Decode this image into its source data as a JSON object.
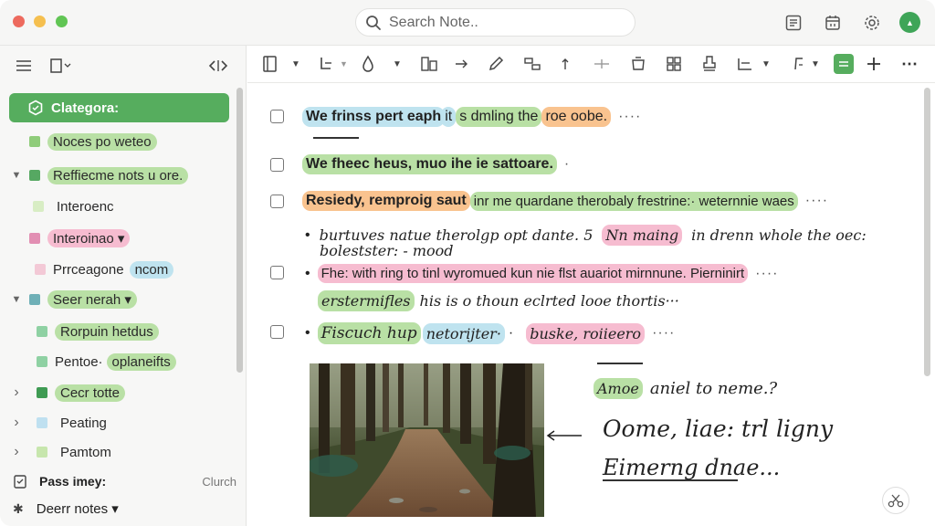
{
  "titlebar": {
    "search_placeholder": "Search Note..",
    "avatar_initial": "▲"
  },
  "sidebar": {
    "category_label": "Clategora:",
    "items": [
      {
        "label": "Noces po weteo",
        "color": "#b9e0a5",
        "sq": "#8fcc7a"
      },
      {
        "label": "Reffiecme nots u ore.",
        "color": "#b9e0a5",
        "sq": "#56a862",
        "chevron": "▼"
      },
      {
        "label": "Interoenc",
        "color": "",
        "sq": "#d8edc4"
      },
      {
        "label": "Interoinao ▾",
        "color": "#f6bcd0",
        "sq": "#e28fb3"
      },
      {
        "label": "Prrceagone",
        "extra": "ncom",
        "color": "",
        "sq": "#f3c9d6"
      },
      {
        "label": "Seer nerah ▾",
        "color": "#b9e0a5",
        "sq": "#6fb0b7",
        "chevron": "▼"
      },
      {
        "label": "Rorpuin hetdus",
        "color": "#b9e0a5",
        "sq": "#8fd1a3"
      },
      {
        "label": "Pentoe·",
        "extra": "oplaneifts",
        "color": "",
        "sq": "#8fd1a3"
      },
      {
        "label": "Cecr totte",
        "color": "#b9e0a5",
        "sq": "#3f9b53",
        "chevron": "›"
      },
      {
        "label": "Peating",
        "color": "",
        "sq": "#bfe0f0",
        "chevron": "›"
      },
      {
        "label": "Pamtom",
        "color": "",
        "sq": "#c7e6ad",
        "chevron": "›"
      }
    ],
    "bottom": {
      "pass_label": "Pass imey:",
      "pass_right": "Clurch",
      "deer_label": "Deerr notes ▾"
    }
  },
  "notes": {
    "line1": {
      "a": "We frinss pert eaph",
      "b": "it",
      "c": "s dmling the",
      "d": "roe oobe.",
      "dots": "····"
    },
    "line2": {
      "a": "We fheec heus, muo ihe ie sattoare.",
      "dots": "·"
    },
    "line3": {
      "a": "Resiedy, remproig saut",
      "b": "inr me quardane therobaly frestrine:· weternnie waes",
      "dots": "····"
    },
    "bullet1": {
      "a": "burtuves natue therolgp opt dante. 5",
      "b": "Nn maing",
      "c": "in drenn whole the oec:"
    },
    "bullet1b": {
      "a": "bolestster: - mood"
    },
    "bullet2": {
      "a": "Fhe: with ring to tinl wyromued kun nie flst auariot mirnnune. Pierninirt",
      "dots": "····"
    },
    "bullet2b": {
      "a": "erstermifles",
      "b": "his is o thoun eclrted looe thortis···"
    },
    "line4": {
      "a": "Fiscuch hup",
      "b": "netorijter·",
      "c": "·",
      "d": "buske, roiieero",
      "dots": "····"
    },
    "hand1": {
      "a": "Amoe",
      "b": "aniel to neme.?"
    },
    "hand2": "Oome, liae: trl ligny",
    "hand3": "Eimerng dnae..."
  },
  "colors": {
    "accent": "#56ad5e",
    "green_hl": "#b9e0a5",
    "blue_hl": "#bfe3ef",
    "orange_hl": "#f9c38f",
    "pink_hl": "#f6bcd0"
  }
}
